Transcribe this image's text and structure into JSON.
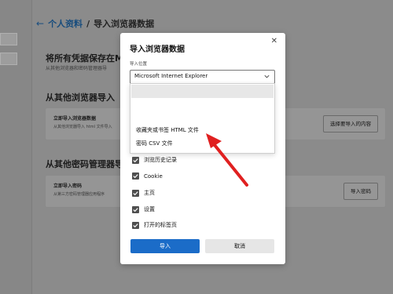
{
  "header": {
    "back_icon": "←",
    "breadcrumb_parent": "个人资料",
    "separator": "/",
    "breadcrumb_current": "导入浏览器数据"
  },
  "section1": {
    "title": "将所有凭据保存在M",
    "subtitle": "从其他浏览器和密码管理器导"
  },
  "section2": {
    "title": "从其他浏览器导入",
    "card_title": "立即导入浏览器数据",
    "card_sub": "从其他浏览器导入 html 文件导入",
    "button": "选择要导入的内容"
  },
  "section3": {
    "title": "从其他密码管理器导",
    "card_title": "立即导入密码",
    "card_sub": "从第三方密码管理器应用程序",
    "button": "导入密码"
  },
  "dialog": {
    "title": "导入浏览器数据",
    "close_icon": "✕",
    "location_label": "导入位置",
    "selected": "Microsoft Internet Explorer",
    "dropdown_options": [
      "收藏夹或书签 HTML 文件",
      "密码 CSV 文件"
    ],
    "checkboxes": [
      "浏览历史记录",
      "Cookie",
      "主页",
      "设置",
      "打开的标签页"
    ],
    "import_button": "导入",
    "cancel_button": "取消"
  },
  "colors": {
    "primary": "#1b6cc8",
    "arrow": "#e02020"
  }
}
